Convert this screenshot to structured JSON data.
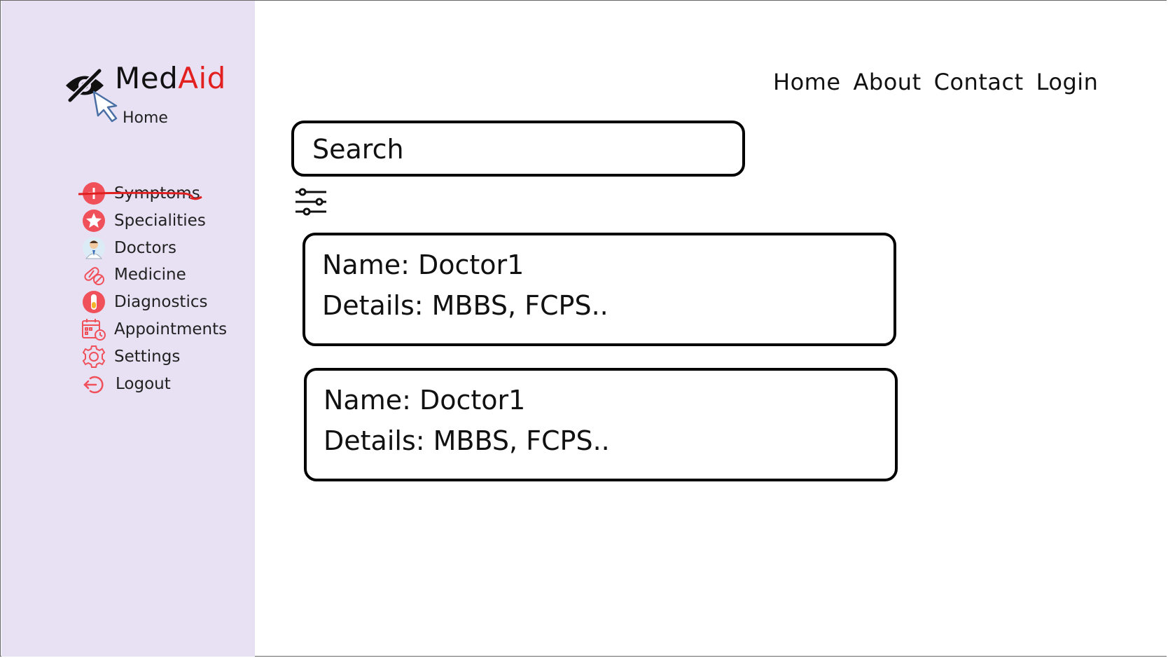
{
  "brand": {
    "name_part1": "Med",
    "name_part2": "Aid",
    "subtitle": "Home"
  },
  "topnav": {
    "items": [
      "Home",
      "About",
      "Contact",
      "Login"
    ]
  },
  "sidebar": {
    "items": [
      {
        "label": "Symptoms",
        "icon": "plus-circle-icon",
        "struck": true
      },
      {
        "label": "Specialities",
        "icon": "star-badge-icon"
      },
      {
        "label": "Doctors",
        "icon": "doctor-icon"
      },
      {
        "label": "Medicine",
        "icon": "pill-icon"
      },
      {
        "label": "Diagnostics",
        "icon": "test-tube-icon"
      },
      {
        "label": "Appointments",
        "icon": "calendar-clock-icon"
      },
      {
        "label": "Settings",
        "icon": "gear-icon"
      },
      {
        "label": "Logout",
        "icon": "logout-icon"
      }
    ]
  },
  "search": {
    "placeholder": "Search"
  },
  "cards": [
    {
      "name": "Name: Doctor1",
      "details": "Details: MBBS, FCPS.."
    },
    {
      "name": "Name: Doctor1",
      "details": "Details: MBBS, FCPS.."
    }
  ],
  "colors": {
    "sidebar_bg": "#e8e1f4",
    "accent_red": "#e32020",
    "icon_red": "#f0505a"
  }
}
